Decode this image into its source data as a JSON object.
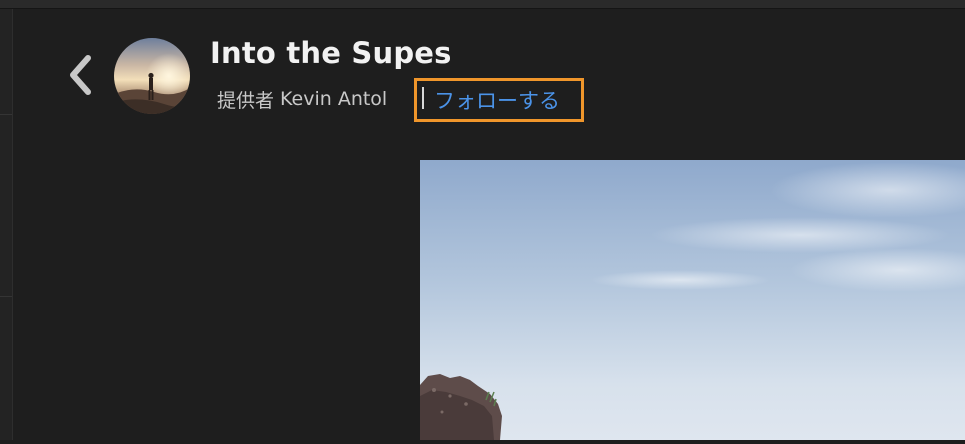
{
  "header": {
    "back_icon": "chevron-left-icon",
    "avatar_icon": "album-avatar-photo",
    "title": "Into the Supes",
    "byline_prefix": "提供者",
    "author": "Kevin Antol",
    "follow_label": "フォローする"
  },
  "colors": {
    "background": "#1e1e1e",
    "title": "#f2f2f2",
    "byline": "#c8c8c8",
    "link": "#4b93e8",
    "highlight": "#f0962b"
  },
  "photo": {
    "icon": "landscape-photo-sky-rocks"
  }
}
